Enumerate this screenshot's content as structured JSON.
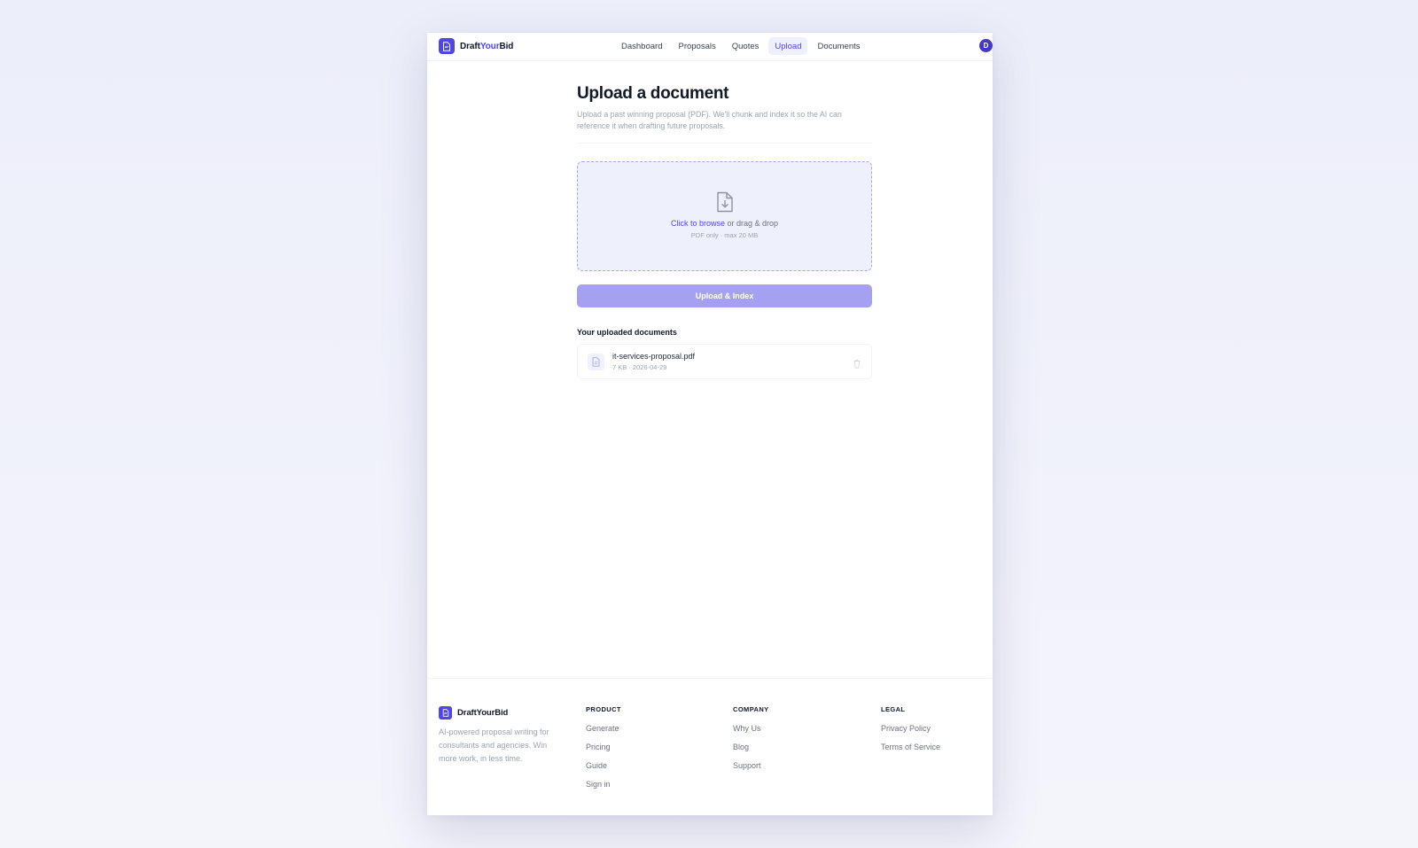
{
  "header": {
    "brand_prefix": "Draft",
    "brand_accent": "Your",
    "brand_suffix": "Bid",
    "nav": [
      {
        "label": "Dashboard",
        "active": false
      },
      {
        "label": "Proposals",
        "active": false
      },
      {
        "label": "Quotes",
        "active": false
      },
      {
        "label": "Upload",
        "active": true
      },
      {
        "label": "Documents",
        "active": false
      }
    ],
    "avatar_initial": "D"
  },
  "main": {
    "title": "Upload a document",
    "description": "Upload a past winning proposal (PDF). We'll chunk and index it so the AI can reference it when drafting future proposals.",
    "dropzone": {
      "icon": "file-download-icon",
      "browse_link": "Click to browse",
      "drag_text": " or drag & drop",
      "hint": "PDF only · max 20 MB"
    },
    "upload_button": "Upload & Index",
    "documents_title": "Your uploaded documents",
    "documents": [
      {
        "name": "it-services-proposal.pdf",
        "meta": "7 KB · 2026-04-29",
        "icon": "file-icon"
      }
    ]
  },
  "footer": {
    "brand": "DraftYourBid",
    "tagline": "AI-powered proposal writing for consultants and agencies. Win more work, in less time.",
    "columns": [
      {
        "heading": "PRODUCT",
        "links": [
          "Generate",
          "Pricing",
          "Guide",
          "Sign in"
        ]
      },
      {
        "heading": "COMPANY",
        "links": [
          "Why Us",
          "Blog",
          "Support"
        ]
      },
      {
        "heading": "LEGAL",
        "links": [
          "Privacy Policy",
          "Terms of Service"
        ]
      }
    ]
  },
  "colors": {
    "accent": "#4f46e5",
    "button": "#a5a0f0",
    "dropzone_bg": "#eef0fb"
  }
}
